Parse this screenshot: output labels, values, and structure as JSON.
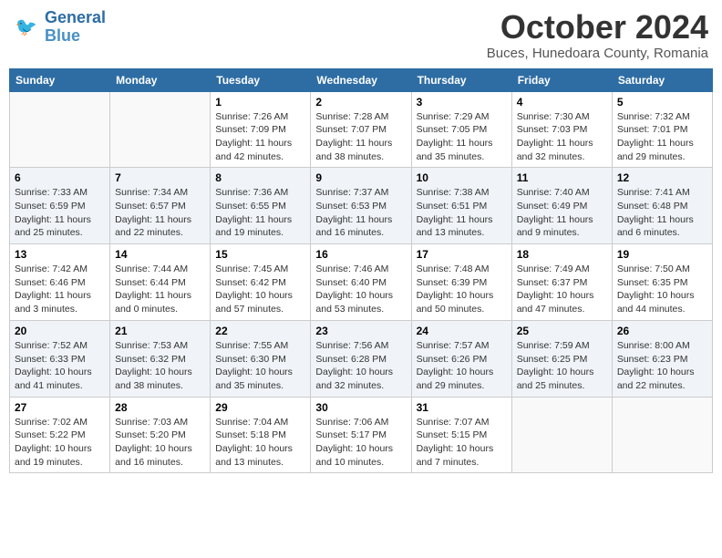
{
  "header": {
    "logo_line1": "General",
    "logo_line2": "Blue",
    "month": "October 2024",
    "location": "Buces, Hunedoara County, Romania"
  },
  "weekdays": [
    "Sunday",
    "Monday",
    "Tuesday",
    "Wednesday",
    "Thursday",
    "Friday",
    "Saturday"
  ],
  "weeks": [
    [
      {
        "day": "",
        "sunrise": "",
        "sunset": "",
        "daylight": ""
      },
      {
        "day": "",
        "sunrise": "",
        "sunset": "",
        "daylight": ""
      },
      {
        "day": "1",
        "sunrise": "Sunrise: 7:26 AM",
        "sunset": "Sunset: 7:09 PM",
        "daylight": "Daylight: 11 hours and 42 minutes."
      },
      {
        "day": "2",
        "sunrise": "Sunrise: 7:28 AM",
        "sunset": "Sunset: 7:07 PM",
        "daylight": "Daylight: 11 hours and 38 minutes."
      },
      {
        "day": "3",
        "sunrise": "Sunrise: 7:29 AM",
        "sunset": "Sunset: 7:05 PM",
        "daylight": "Daylight: 11 hours and 35 minutes."
      },
      {
        "day": "4",
        "sunrise": "Sunrise: 7:30 AM",
        "sunset": "Sunset: 7:03 PM",
        "daylight": "Daylight: 11 hours and 32 minutes."
      },
      {
        "day": "5",
        "sunrise": "Sunrise: 7:32 AM",
        "sunset": "Sunset: 7:01 PM",
        "daylight": "Daylight: 11 hours and 29 minutes."
      }
    ],
    [
      {
        "day": "6",
        "sunrise": "Sunrise: 7:33 AM",
        "sunset": "Sunset: 6:59 PM",
        "daylight": "Daylight: 11 hours and 25 minutes."
      },
      {
        "day": "7",
        "sunrise": "Sunrise: 7:34 AM",
        "sunset": "Sunset: 6:57 PM",
        "daylight": "Daylight: 11 hours and 22 minutes."
      },
      {
        "day": "8",
        "sunrise": "Sunrise: 7:36 AM",
        "sunset": "Sunset: 6:55 PM",
        "daylight": "Daylight: 11 hours and 19 minutes."
      },
      {
        "day": "9",
        "sunrise": "Sunrise: 7:37 AM",
        "sunset": "Sunset: 6:53 PM",
        "daylight": "Daylight: 11 hours and 16 minutes."
      },
      {
        "day": "10",
        "sunrise": "Sunrise: 7:38 AM",
        "sunset": "Sunset: 6:51 PM",
        "daylight": "Daylight: 11 hours and 13 minutes."
      },
      {
        "day": "11",
        "sunrise": "Sunrise: 7:40 AM",
        "sunset": "Sunset: 6:49 PM",
        "daylight": "Daylight: 11 hours and 9 minutes."
      },
      {
        "day": "12",
        "sunrise": "Sunrise: 7:41 AM",
        "sunset": "Sunset: 6:48 PM",
        "daylight": "Daylight: 11 hours and 6 minutes."
      }
    ],
    [
      {
        "day": "13",
        "sunrise": "Sunrise: 7:42 AM",
        "sunset": "Sunset: 6:46 PM",
        "daylight": "Daylight: 11 hours and 3 minutes."
      },
      {
        "day": "14",
        "sunrise": "Sunrise: 7:44 AM",
        "sunset": "Sunset: 6:44 PM",
        "daylight": "Daylight: 11 hours and 0 minutes."
      },
      {
        "day": "15",
        "sunrise": "Sunrise: 7:45 AM",
        "sunset": "Sunset: 6:42 PM",
        "daylight": "Daylight: 10 hours and 57 minutes."
      },
      {
        "day": "16",
        "sunrise": "Sunrise: 7:46 AM",
        "sunset": "Sunset: 6:40 PM",
        "daylight": "Daylight: 10 hours and 53 minutes."
      },
      {
        "day": "17",
        "sunrise": "Sunrise: 7:48 AM",
        "sunset": "Sunset: 6:39 PM",
        "daylight": "Daylight: 10 hours and 50 minutes."
      },
      {
        "day": "18",
        "sunrise": "Sunrise: 7:49 AM",
        "sunset": "Sunset: 6:37 PM",
        "daylight": "Daylight: 10 hours and 47 minutes."
      },
      {
        "day": "19",
        "sunrise": "Sunrise: 7:50 AM",
        "sunset": "Sunset: 6:35 PM",
        "daylight": "Daylight: 10 hours and 44 minutes."
      }
    ],
    [
      {
        "day": "20",
        "sunrise": "Sunrise: 7:52 AM",
        "sunset": "Sunset: 6:33 PM",
        "daylight": "Daylight: 10 hours and 41 minutes."
      },
      {
        "day": "21",
        "sunrise": "Sunrise: 7:53 AM",
        "sunset": "Sunset: 6:32 PM",
        "daylight": "Daylight: 10 hours and 38 minutes."
      },
      {
        "day": "22",
        "sunrise": "Sunrise: 7:55 AM",
        "sunset": "Sunset: 6:30 PM",
        "daylight": "Daylight: 10 hours and 35 minutes."
      },
      {
        "day": "23",
        "sunrise": "Sunrise: 7:56 AM",
        "sunset": "Sunset: 6:28 PM",
        "daylight": "Daylight: 10 hours and 32 minutes."
      },
      {
        "day": "24",
        "sunrise": "Sunrise: 7:57 AM",
        "sunset": "Sunset: 6:26 PM",
        "daylight": "Daylight: 10 hours and 29 minutes."
      },
      {
        "day": "25",
        "sunrise": "Sunrise: 7:59 AM",
        "sunset": "Sunset: 6:25 PM",
        "daylight": "Daylight: 10 hours and 25 minutes."
      },
      {
        "day": "26",
        "sunrise": "Sunrise: 8:00 AM",
        "sunset": "Sunset: 6:23 PM",
        "daylight": "Daylight: 10 hours and 22 minutes."
      }
    ],
    [
      {
        "day": "27",
        "sunrise": "Sunrise: 7:02 AM",
        "sunset": "Sunset: 5:22 PM",
        "daylight": "Daylight: 10 hours and 19 minutes."
      },
      {
        "day": "28",
        "sunrise": "Sunrise: 7:03 AM",
        "sunset": "Sunset: 5:20 PM",
        "daylight": "Daylight: 10 hours and 16 minutes."
      },
      {
        "day": "29",
        "sunrise": "Sunrise: 7:04 AM",
        "sunset": "Sunset: 5:18 PM",
        "daylight": "Daylight: 10 hours and 13 minutes."
      },
      {
        "day": "30",
        "sunrise": "Sunrise: 7:06 AM",
        "sunset": "Sunset: 5:17 PM",
        "daylight": "Daylight: 10 hours and 10 minutes."
      },
      {
        "day": "31",
        "sunrise": "Sunrise: 7:07 AM",
        "sunset": "Sunset: 5:15 PM",
        "daylight": "Daylight: 10 hours and 7 minutes."
      },
      {
        "day": "",
        "sunrise": "",
        "sunset": "",
        "daylight": ""
      },
      {
        "day": "",
        "sunrise": "",
        "sunset": "",
        "daylight": ""
      }
    ]
  ]
}
